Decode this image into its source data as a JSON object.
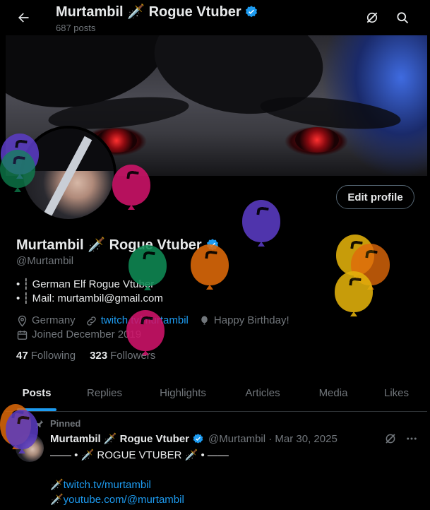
{
  "header": {
    "title": "Murtambil 🗡️ Rogue Vtuber",
    "post_count": "687 posts"
  },
  "profile": {
    "name": "Murtambil 🗡️ Rogue Vtuber",
    "handle": "@Murtambil",
    "bio_lines": [
      "• ┆ German Elf Rogue Vtuber",
      "• ┆ Mail: murtambil@gmail.com"
    ],
    "location": "Germany",
    "website": "twitch.tv/murtambil",
    "birthday": "Happy Birthday!",
    "joined": "Joined December 2019",
    "following_count": "47",
    "following_label": "Following",
    "followers_count": "323",
    "followers_label": "Followers",
    "edit_label": "Edit profile"
  },
  "tabs": [
    {
      "label": "Posts",
      "active": true
    },
    {
      "label": "Replies"
    },
    {
      "label": "Highlights"
    },
    {
      "label": "Articles"
    },
    {
      "label": "Media"
    },
    {
      "label": "Likes"
    }
  ],
  "post": {
    "pinned_label": "Pinned",
    "author_name": "Murtambil 🗡️ Rogue Vtuber",
    "author_meta": "@Murtambil · Mar 30, 2025",
    "lines": [
      "—— • 🗡️ ROGUE VTUBER 🗡️ • ——",
      "",
      "🗡️twitch.tv/murtambil",
      "🗡️youtube.com/@murtambil"
    ]
  },
  "colors": {
    "accent": "#1d9bf0",
    "balloon_purple": "#5b3cc4",
    "balloon_pink": "#d0146a",
    "balloon_green": "#0f8a55",
    "balloon_orange": "#e06a0a",
    "balloon_yellow": "#e3b20c"
  },
  "icons": [
    "back-arrow-icon",
    "grok-icon",
    "search-icon",
    "verified-badge-icon",
    "location-pin-icon",
    "link-icon",
    "balloon-icon",
    "calendar-icon",
    "pin-icon",
    "more-icon"
  ]
}
